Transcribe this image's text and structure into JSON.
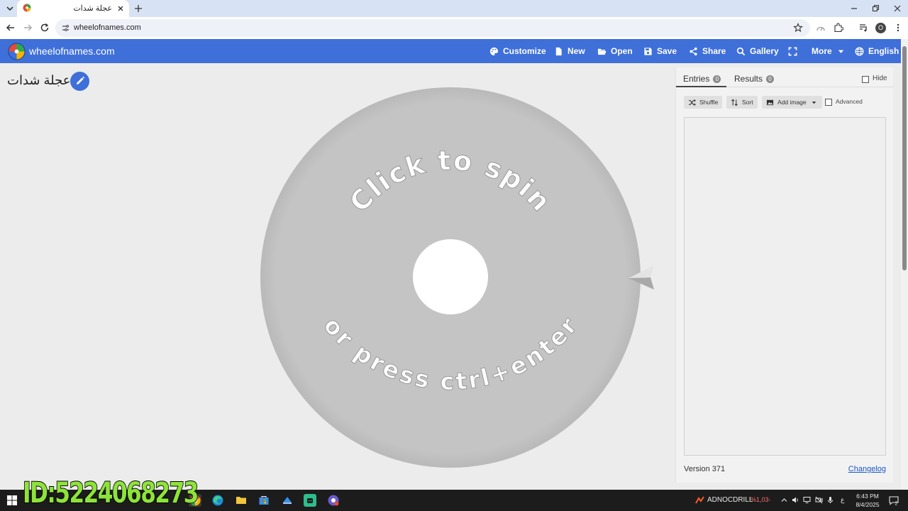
{
  "browser": {
    "tab_title": "عجلة شدات",
    "url": "wheelofnames.com",
    "profile_initial": "O"
  },
  "navbar": {
    "site_name": "wheelofnames.com",
    "items": [
      {
        "label": "Customize",
        "icon": "palette-icon"
      },
      {
        "label": "New",
        "icon": "file-icon"
      },
      {
        "label": "Open",
        "icon": "folder-open-icon"
      },
      {
        "label": "Save",
        "icon": "save-icon"
      },
      {
        "label": "Share",
        "icon": "share-icon"
      },
      {
        "label": "Gallery",
        "icon": "search-icon"
      },
      {
        "label": "",
        "icon": "fullscreen-icon"
      },
      {
        "label": "More",
        "icon": "chevron-down-icon"
      },
      {
        "label": "English",
        "icon": "globe-icon"
      }
    ],
    "color": "#3f6fd8"
  },
  "wheel": {
    "title": "عجلة شدات",
    "top_text": "Click to spin",
    "bottom_text": "or press ctrl+enter"
  },
  "panel": {
    "tabs": [
      {
        "label": "Entries",
        "count": "0"
      },
      {
        "label": "Results",
        "count": "0"
      }
    ],
    "hide_label": "Hide",
    "shuffle_label": "Shuffle",
    "sort_label": "Sort",
    "add_image_label": "Add image",
    "advanced_label": "Advanced",
    "version": "Version 371",
    "changelog": "Changelog"
  },
  "taskbar": {
    "ticker_name": "ADNOCDRILL",
    "ticker_change": "%1,03-",
    "lang": "ع",
    "time": "6:43 PM",
    "date": "8/4/2025",
    "notifications": "2"
  },
  "overlay_id": "ID:5224068273"
}
